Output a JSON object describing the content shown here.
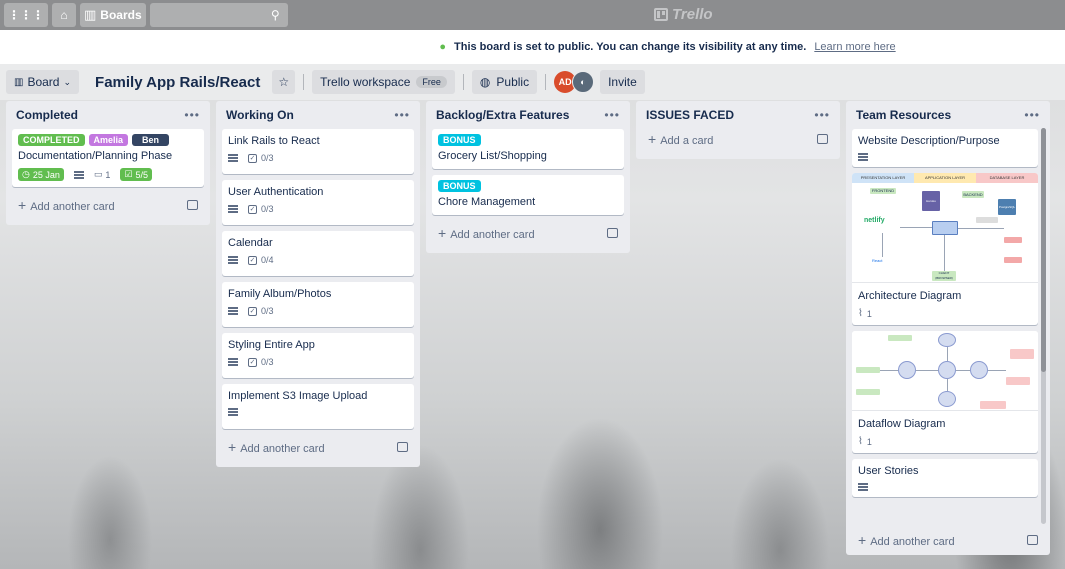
{
  "topnav": {
    "boards_label": "Boards",
    "search_placeholder": "",
    "logo_text": "Trello"
  },
  "banner": {
    "message": "This board is set to public. You can change its visibility at any time.",
    "link": "Learn more here"
  },
  "header": {
    "view_label": "Board",
    "title": "Family App Rails/React",
    "workspace_label": "Trello workspace",
    "plan_badge": "Free",
    "visibility_label": "Public",
    "members": [
      {
        "initials": "AD",
        "color": "#d94c2b"
      },
      {
        "initials": "",
        "color": "#5a6a7a"
      }
    ],
    "invite_label": "Invite"
  },
  "lists": [
    {
      "title": "Completed",
      "add_label": "Add another card",
      "cards": [
        {
          "labels": [
            {
              "text": "COMPLETED",
              "color": "#61bd4f"
            },
            {
              "text": "Amelia",
              "color": "#c377e0"
            },
            {
              "text": "Ben",
              "color": "#344563"
            }
          ],
          "title": "Documentation/Planning Phase",
          "due": "25 Jan",
          "comments": "1",
          "checklist": "5/5"
        }
      ]
    },
    {
      "title": "Working On",
      "add_label": "Add another card",
      "cards": [
        {
          "title": "Link Rails to React",
          "checklist": "0/3"
        },
        {
          "title": "User Authentication",
          "checklist": "0/3"
        },
        {
          "title": "Calendar",
          "checklist": "0/4"
        },
        {
          "title": "Family Album/Photos",
          "checklist": "0/3"
        },
        {
          "title": "Styling Entire App",
          "checklist": "0/3"
        },
        {
          "title": "Implement S3 Image Upload"
        }
      ]
    },
    {
      "title": "Backlog/Extra Features",
      "add_label": "Add another card",
      "cards": [
        {
          "labels": [
            {
              "text": "BONUS",
              "color": "#00c2e0"
            }
          ],
          "title": "Grocery List/Shopping"
        },
        {
          "labels": [
            {
              "text": "BONUS",
              "color": "#00c2e0"
            }
          ],
          "title": "Chore Management"
        }
      ]
    },
    {
      "title": "ISSUES FACED",
      "add_label": "Add a card",
      "cards": []
    },
    {
      "title": "Team Resources",
      "add_label": "Add another card",
      "cards": [
        {
          "title": "Website Description/Purpose"
        },
        {
          "title": "Architecture Diagram",
          "attachments": "1",
          "cover_columns": [
            "PRESENTATION LAYER",
            "APPLICATION LAYER",
            "DATABASE LAYER"
          ],
          "cover_tags": [
            "FRONTEND",
            "BACKEND",
            "netlify",
            "React",
            "CLIENT (BROWSER)",
            "Heroku",
            "PostgreSQL"
          ]
        },
        {
          "title": "Dataflow Diagram",
          "attachments": "1"
        },
        {
          "title": "User Stories"
        }
      ]
    }
  ]
}
